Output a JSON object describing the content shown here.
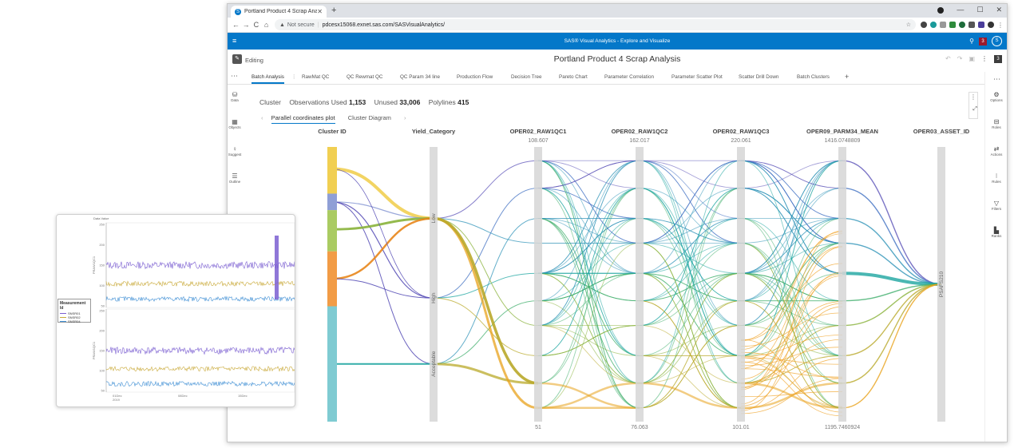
{
  "browser": {
    "tab_title": "Portland Product 4 Scrap Analys",
    "tab_close": "✕",
    "new_tab": "+",
    "minimize": "—",
    "maximize": "☐",
    "close": "✕",
    "nav": {
      "back": "←",
      "forward": "→",
      "reload": "C",
      "home": "⌂"
    },
    "not_secure": "Not secure",
    "url": "pdcesx15068.exnet.sas.com/SASVisualAnalytics/",
    "bookmark_star": "☆",
    "menu": "⋮"
  },
  "sas_header": {
    "menu_icon": "≡",
    "product": "SAS® Visual Analytics - Explore and Visualize",
    "search_icon": "⚲",
    "badge": "3",
    "user": "S"
  },
  "report": {
    "editing_label": "Editing",
    "title": "Portland Product 4 Scrap Analysis",
    "badge": "3",
    "more": "⋮"
  },
  "page_tabs": [
    "Batch Analysis",
    "RawMat QC",
    "QC Rewmat QC",
    "QC Param 34 line",
    "Production Flow",
    "Decision Tree",
    "Pareto Chart",
    "Parameter Correlation",
    "Parameter Scatter Plot",
    "Scatter Drill Down",
    "Batch Clusters"
  ],
  "page_tabs_add": "+",
  "left_panel": [
    {
      "label": "Data",
      "icon": "database-icon",
      "glyph": "⛁"
    },
    {
      "label": "Objects",
      "icon": "objects-icon",
      "glyph": "▦"
    },
    {
      "label": "Suggest",
      "icon": "lightbulb-icon",
      "glyph": "♀"
    },
    {
      "label": "Outline",
      "icon": "outline-icon",
      "glyph": "☰"
    }
  ],
  "right_panel": [
    {
      "label": "Options",
      "icon": "options-icon",
      "glyph": "⚙"
    },
    {
      "label": "Roles",
      "icon": "roles-icon",
      "glyph": "⊟"
    },
    {
      "label": "Actions",
      "icon": "actions-icon",
      "glyph": "⇄"
    },
    {
      "label": "Rules",
      "icon": "rules-icon",
      "glyph": "⁝"
    },
    {
      "label": "Filters",
      "icon": "filter-icon",
      "glyph": "▽"
    },
    {
      "label": "Ranks",
      "icon": "ranks-icon",
      "glyph": "▙"
    }
  ],
  "summary": {
    "cluster": "Cluster",
    "obs_label": "Observations Used",
    "obs_value": "1,153",
    "unused_label": "Unused",
    "unused_value": "33,006",
    "poly_label": "Polylines",
    "poly_value": "415"
  },
  "sub_tabs": [
    "Parallel coordinates plot",
    "Cluster Diagram"
  ],
  "chart_data": {
    "type": "parallel_coordinates",
    "axes": [
      {
        "name": "Cluster ID",
        "top": "",
        "bottom": ""
      },
      {
        "name": "Yield_Category",
        "top": "",
        "bottom": "",
        "categories": [
          "Low",
          "High",
          "Acceptable"
        ]
      },
      {
        "name": "OPER02_RAW1QC1",
        "top": "108.607",
        "bottom": "51"
      },
      {
        "name": "OPER02_RAW1QC2",
        "top": "162.017",
        "bottom": "76.063"
      },
      {
        "name": "OPER02_RAW1QC3",
        "top": "220.061",
        "bottom": "101.01"
      },
      {
        "name": "OPER09_PARM34_MEAN",
        "top": "1416.0748809",
        "bottom": "1195.7460924"
      },
      {
        "name": "OPER03_ASSET_ID",
        "top": "",
        "bottom": "",
        "categories": [
          "PSAFS210"
        ]
      }
    ],
    "cluster_colors": [
      "#f1cf52",
      "#8f9fd6",
      "#aacb62",
      "#f29c46",
      "#7fcbd2"
    ],
    "cluster_segments": [
      {
        "cluster": 1,
        "fraction_start": 0.0,
        "fraction_end": 0.17,
        "color": "#f1cf52"
      },
      {
        "cluster": 2,
        "fraction_start": 0.17,
        "fraction_end": 0.23,
        "color": "#8f9fd6"
      },
      {
        "cluster": 3,
        "fraction_start": 0.23,
        "fraction_end": 0.38,
        "color": "#aacb62"
      },
      {
        "cluster": 4,
        "fraction_start": 0.38,
        "fraction_end": 0.58,
        "color": "#f29c46"
      },
      {
        "cluster": 5,
        "fraction_start": 0.58,
        "fraction_end": 1.0,
        "color": "#7fcbd2"
      }
    ]
  },
  "inset_chart": {
    "y_title": "Data Value",
    "x_ticks": [
      "01Dec\n2019",
      "08Dec",
      "15Dec"
    ],
    "upper_y_ticks": [
      "250",
      "200",
      "150",
      "100",
      "50"
    ],
    "lower_y_ticks": [
      "250",
      "200",
      "150",
      "100",
      "50"
    ],
    "panel_labels": [
      "PRAW1QC1",
      "PRAW1QC1"
    ],
    "legend_title": "Measurement Id",
    "legend": [
      {
        "name": "SNSR01",
        "color": "#7b5fd1"
      },
      {
        "name": "SNSR02",
        "color": "#c9a938"
      },
      {
        "name": "SNSR04",
        "color": "#3e8ed4"
      }
    ]
  }
}
